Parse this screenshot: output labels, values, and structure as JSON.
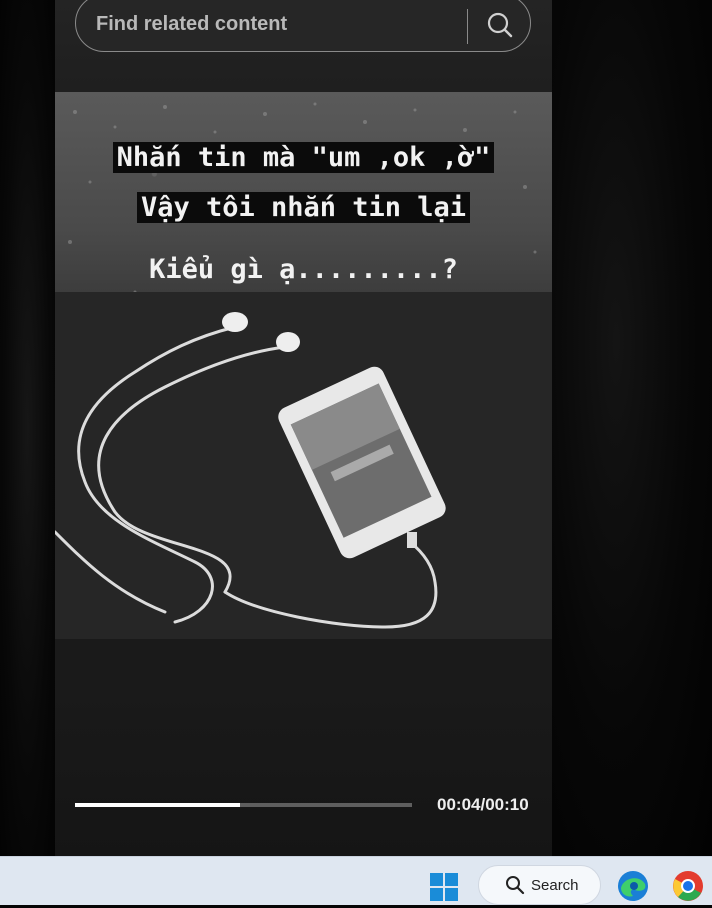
{
  "search": {
    "placeholder": "Find related content"
  },
  "video": {
    "caption_lines": [
      "Nhắn tin mà \"um ,ok ,ờ\"",
      "Vậy tôi nhắn tin lại",
      "Kiểu gì ạ.........?"
    ],
    "progress_fraction": 0.49,
    "time_display": "00:04/00:10"
  },
  "taskbar": {
    "search_label": "Search",
    "apps": [
      "windows-start-icon",
      "edge-icon",
      "chrome-icon"
    ]
  }
}
